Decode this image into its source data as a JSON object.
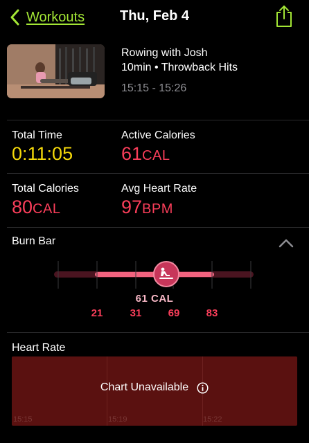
{
  "nav": {
    "back_label": "Workouts",
    "title": "Thu, Feb 4",
    "back_icon": "chevron-left-icon",
    "share_icon": "share-icon",
    "accent_color": "#a3e635"
  },
  "workout": {
    "title": "Rowing with Josh",
    "subtitle": "10min • Throwback Hits",
    "time_range": "15:15 - 15:26"
  },
  "stats": {
    "total_time": {
      "label": "Total Time",
      "value": "0:11:05"
    },
    "active_calories": {
      "label": "Active Calories",
      "value": "61",
      "unit": "CAL"
    },
    "total_calories": {
      "label": "Total Calories",
      "value": "80",
      "unit": "CAL"
    },
    "avg_heart_rate": {
      "label": "Avg Heart Rate",
      "value": "97",
      "unit": "BPM"
    }
  },
  "burn_bar": {
    "title": "Burn Bar",
    "current_label": "61 CAL",
    "current_value": 61,
    "ticks": [
      "21",
      "31",
      "69",
      "83"
    ],
    "icon": "rower-icon",
    "collapse_icon": "chevron-up-icon"
  },
  "heart_rate": {
    "title": "Heart Rate",
    "message": "Chart Unavailable",
    "info_icon": "info-icon",
    "time_ticks": [
      "15:15",
      "15:19",
      "15:22"
    ]
  },
  "colors": {
    "yellow": "#f5d90a",
    "red": "#fa3e5a",
    "hr_background": "#5a1110"
  }
}
